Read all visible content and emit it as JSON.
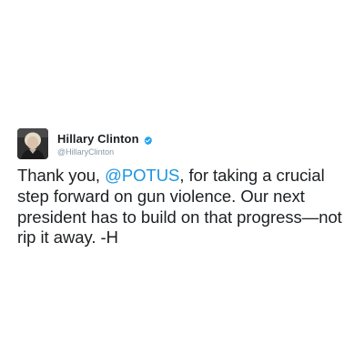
{
  "tweet": {
    "author": {
      "display_name": "Hillary Clinton",
      "handle": "@HillaryClinton",
      "verified": true,
      "avatar_icon": "profile-photo"
    },
    "text": {
      "before_mention": "Thank you, ",
      "mention": "@POTUS",
      "line1_after": ", for taking a crucial",
      "line2": "step forward on gun violence. Our next",
      "line3": "president has to build on that progress—not",
      "line4": "rip it away. -H"
    }
  },
  "colors": {
    "mention": "#1b95e0",
    "verified_badge": "#1da1f2",
    "handle": "#8899a6",
    "text": "#1c2023"
  }
}
